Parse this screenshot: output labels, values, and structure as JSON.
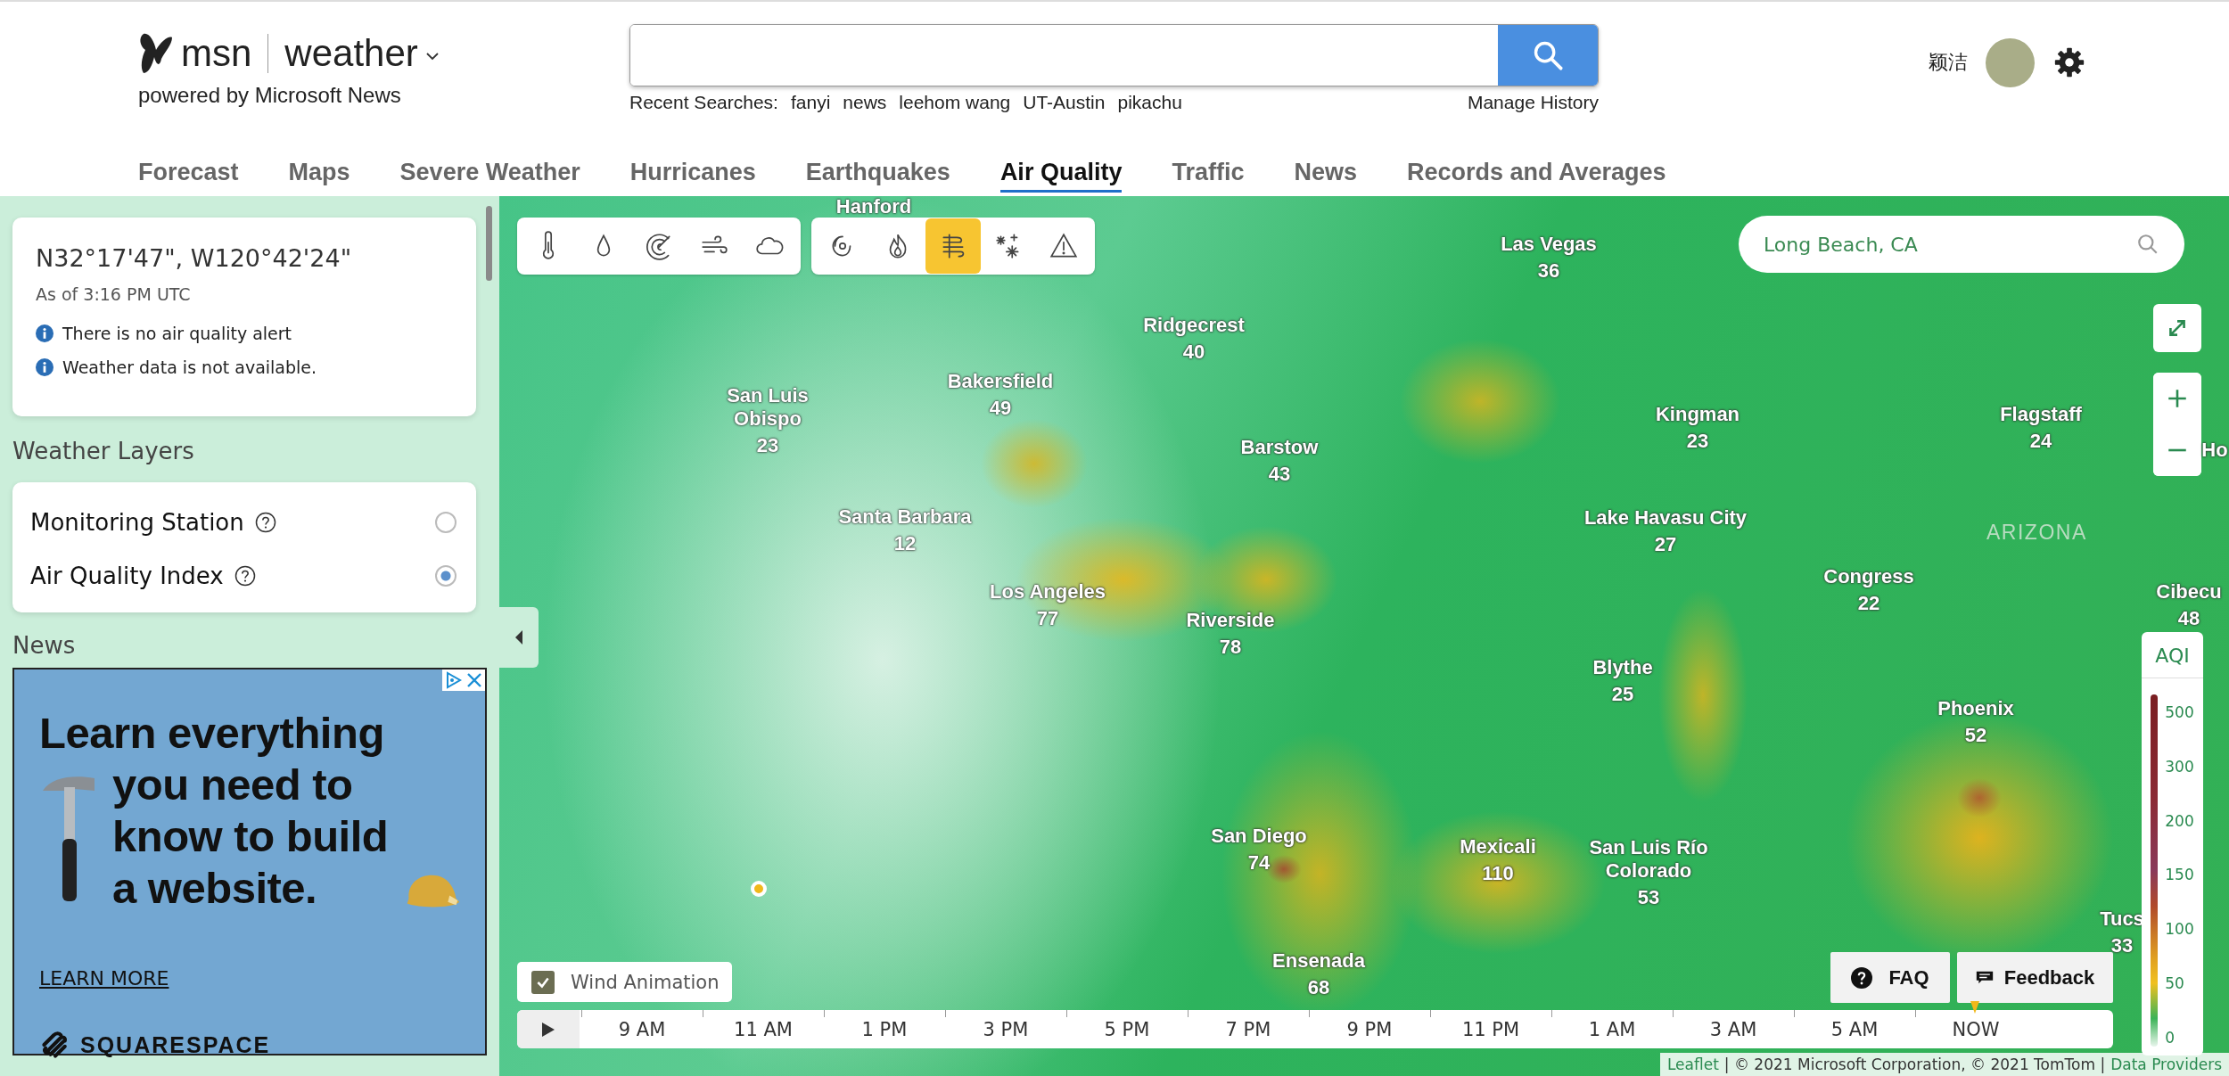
{
  "header": {
    "logo": {
      "brand": "msn",
      "product": "weather",
      "tagline": "powered by Microsoft News"
    },
    "search": {
      "recent_label": "Recent Searches:",
      "recent": [
        "fanyi",
        "news",
        "leehom wang",
        "UT-Austin",
        "pikachu"
      ],
      "manage": "Manage History"
    },
    "user": {
      "name": "颖洁"
    }
  },
  "nav": [
    {
      "label": "Forecast",
      "selected": false
    },
    {
      "label": "Maps",
      "selected": false
    },
    {
      "label": "Severe Weather",
      "selected": false
    },
    {
      "label": "Hurricanes",
      "selected": false
    },
    {
      "label": "Earthquakes",
      "selected": false
    },
    {
      "label": "Air Quality",
      "selected": true
    },
    {
      "label": "Traffic",
      "selected": false
    },
    {
      "label": "News",
      "selected": false
    },
    {
      "label": "Records and Averages",
      "selected": false
    }
  ],
  "location_card": {
    "coordinates": "N32°17'47\", W120°42'24\"",
    "as_of": "As of 3:16 PM UTC",
    "notes": [
      "There is no air quality alert",
      "Weather data is not available."
    ]
  },
  "weather_layers": {
    "title": "Weather Layers",
    "items": [
      {
        "label": "Monitoring Station",
        "selected": false
      },
      {
        "label": "Air Quality Index",
        "selected": true
      }
    ]
  },
  "news": {
    "title": "News"
  },
  "ad": {
    "headline": [
      "Learn everything",
      "you need to know to build a website."
    ],
    "cta": "LEARN MORE",
    "brand": "SQUARESPACE"
  },
  "map": {
    "layer_groups": [
      [
        {
          "kind": "temperature",
          "selected": false
        },
        {
          "kind": "precipitation",
          "selected": false
        },
        {
          "kind": "radar",
          "selected": false
        },
        {
          "kind": "wind",
          "selected": false
        },
        {
          "kind": "cloud",
          "selected": false
        }
      ],
      [
        {
          "kind": "hurricane",
          "selected": false
        },
        {
          "kind": "fire",
          "selected": false
        },
        {
          "kind": "air",
          "selected": true
        },
        {
          "kind": "snow",
          "selected": false
        },
        {
          "kind": "warning",
          "selected": false
        }
      ]
    ],
    "search": {
      "value": "Long Beach, CA"
    },
    "labels": [
      {
        "name": "Hanford"
      },
      {
        "name": "Las Vegas",
        "value": "36"
      },
      {
        "name": "Ridgecrest",
        "value": "40"
      },
      {
        "name": "Bakersfield",
        "value": "49"
      },
      {
        "name": "San Luis Obispo",
        "value": "23"
      },
      {
        "name": "Barstow",
        "value": "43"
      },
      {
        "name": "Kingman",
        "value": "23"
      },
      {
        "name": "Flagstaff",
        "value": "24"
      },
      {
        "name": "Santa Barbara",
        "value": "12"
      },
      {
        "name": "Lake Havasu City",
        "value": "27"
      },
      {
        "name": "Congress",
        "value": "22"
      },
      {
        "name": "Los Angeles",
        "value": "77"
      },
      {
        "name": "Cibecu",
        "value": "48"
      },
      {
        "name": "Riverside",
        "value": "78"
      },
      {
        "name": "Blythe",
        "value": "25"
      },
      {
        "name": "Phoenix",
        "value": "52"
      },
      {
        "name": "San Diego",
        "value": "74"
      },
      {
        "name": "Mexicali",
        "value": "110"
      },
      {
        "name": "San Luis Río Colorado",
        "value": "53"
      },
      {
        "name": "Ensenada",
        "value": "68"
      },
      {
        "name": "Tucs",
        "value": "33"
      },
      {
        "name": "Ho"
      }
    ],
    "region_label": "ARIZONA",
    "legend": {
      "title": "AQI",
      "ticks": [
        "500",
        "300",
        "200",
        "150",
        "100",
        "50",
        "0"
      ]
    },
    "faq": "FAQ",
    "feedback": "Feedback",
    "wind_animation": {
      "label": "Wind Animation",
      "checked": true
    },
    "timeline": [
      {
        "label": "9 AM",
        "selected": false
      },
      {
        "label": "11 AM",
        "selected": false
      },
      {
        "label": "1 PM",
        "selected": false
      },
      {
        "label": "3 PM",
        "selected": false
      },
      {
        "label": "5 PM",
        "selected": false
      },
      {
        "label": "7 PM",
        "selected": false
      },
      {
        "label": "9 PM",
        "selected": false
      },
      {
        "label": "11 PM",
        "selected": false
      },
      {
        "label": "1 AM",
        "selected": false
      },
      {
        "label": "3 AM",
        "selected": false
      },
      {
        "label": "5 AM",
        "selected": false
      },
      {
        "label": "NOW",
        "selected": true
      }
    ],
    "attribution": {
      "leaflet": "Leaflet",
      "text": "| © 2021 Microsoft Corporation, © 2021 TomTom |",
      "providers": "Data Providers"
    }
  }
}
